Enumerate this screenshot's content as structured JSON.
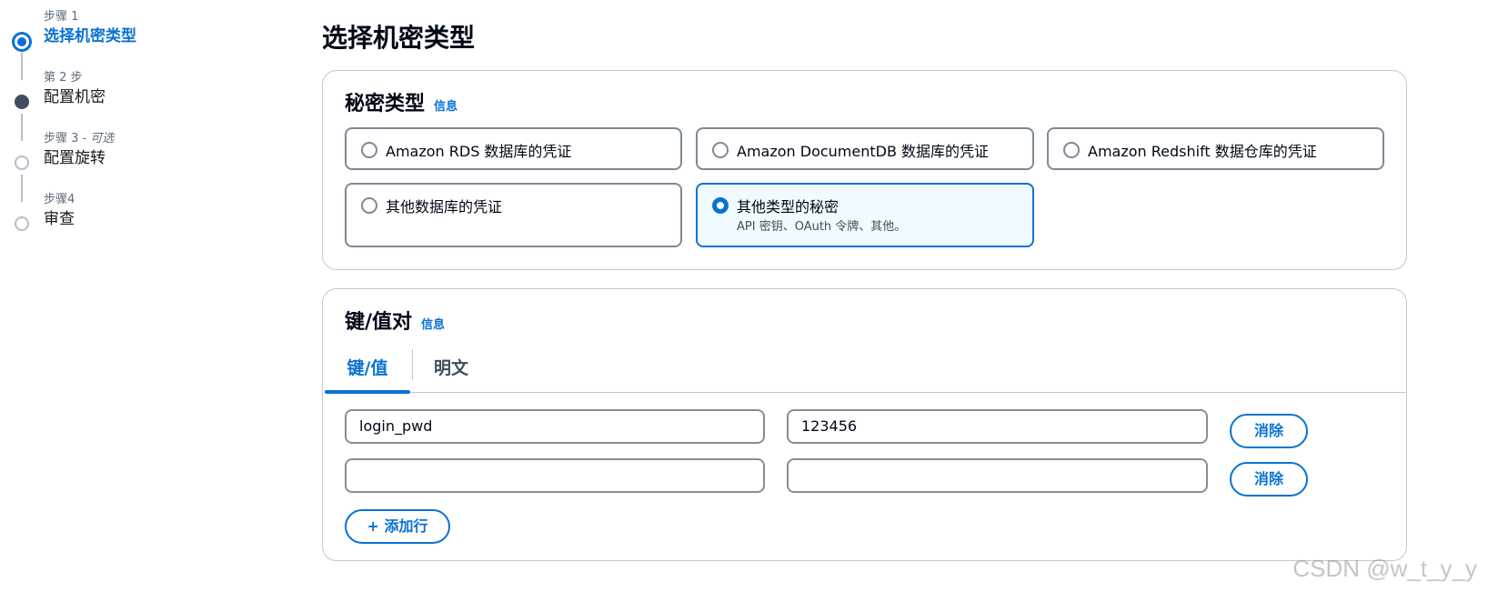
{
  "steps": [
    {
      "label": "步骤 1",
      "title": "选择机密类型",
      "state": "current"
    },
    {
      "label": "第 2 步",
      "title": "配置机密",
      "state": "done"
    },
    {
      "label": "步骤 3 - ",
      "optional": "可选",
      "title": "配置旋转",
      "state": "pending"
    },
    {
      "label": "步骤4",
      "title": "审查",
      "state": "pending"
    }
  ],
  "page_title": "选择机密类型",
  "secret_type": {
    "heading": "秘密类型",
    "info": "信息",
    "tiles": [
      {
        "title": "Amazon RDS 数据库的凭证",
        "selected": false
      },
      {
        "title": "Amazon DocumentDB 数据库的凭证",
        "selected": false
      },
      {
        "title": "Amazon Redshift 数据仓库的凭证",
        "selected": false
      },
      {
        "title": "其他数据库的凭证",
        "selected": false
      },
      {
        "title": "其他类型的秘密",
        "subtitle": "API 密钥、OAuth 令牌、其他。",
        "selected": true
      }
    ]
  },
  "kv": {
    "heading": "键/值对",
    "info": "信息",
    "tabs": [
      {
        "label": "键/值",
        "active": true
      },
      {
        "label": "明文",
        "active": false
      }
    ],
    "rows": [
      {
        "key": "login_pwd",
        "value": "123456",
        "remove": "消除"
      },
      {
        "key": "",
        "value": "",
        "remove": "消除"
      }
    ],
    "add_row": "+ 添加行"
  },
  "watermark": "CSDN @w_t_y_y",
  "colors": {
    "accent": "#0972d3",
    "text": "#000716",
    "border": "#7d8998"
  }
}
